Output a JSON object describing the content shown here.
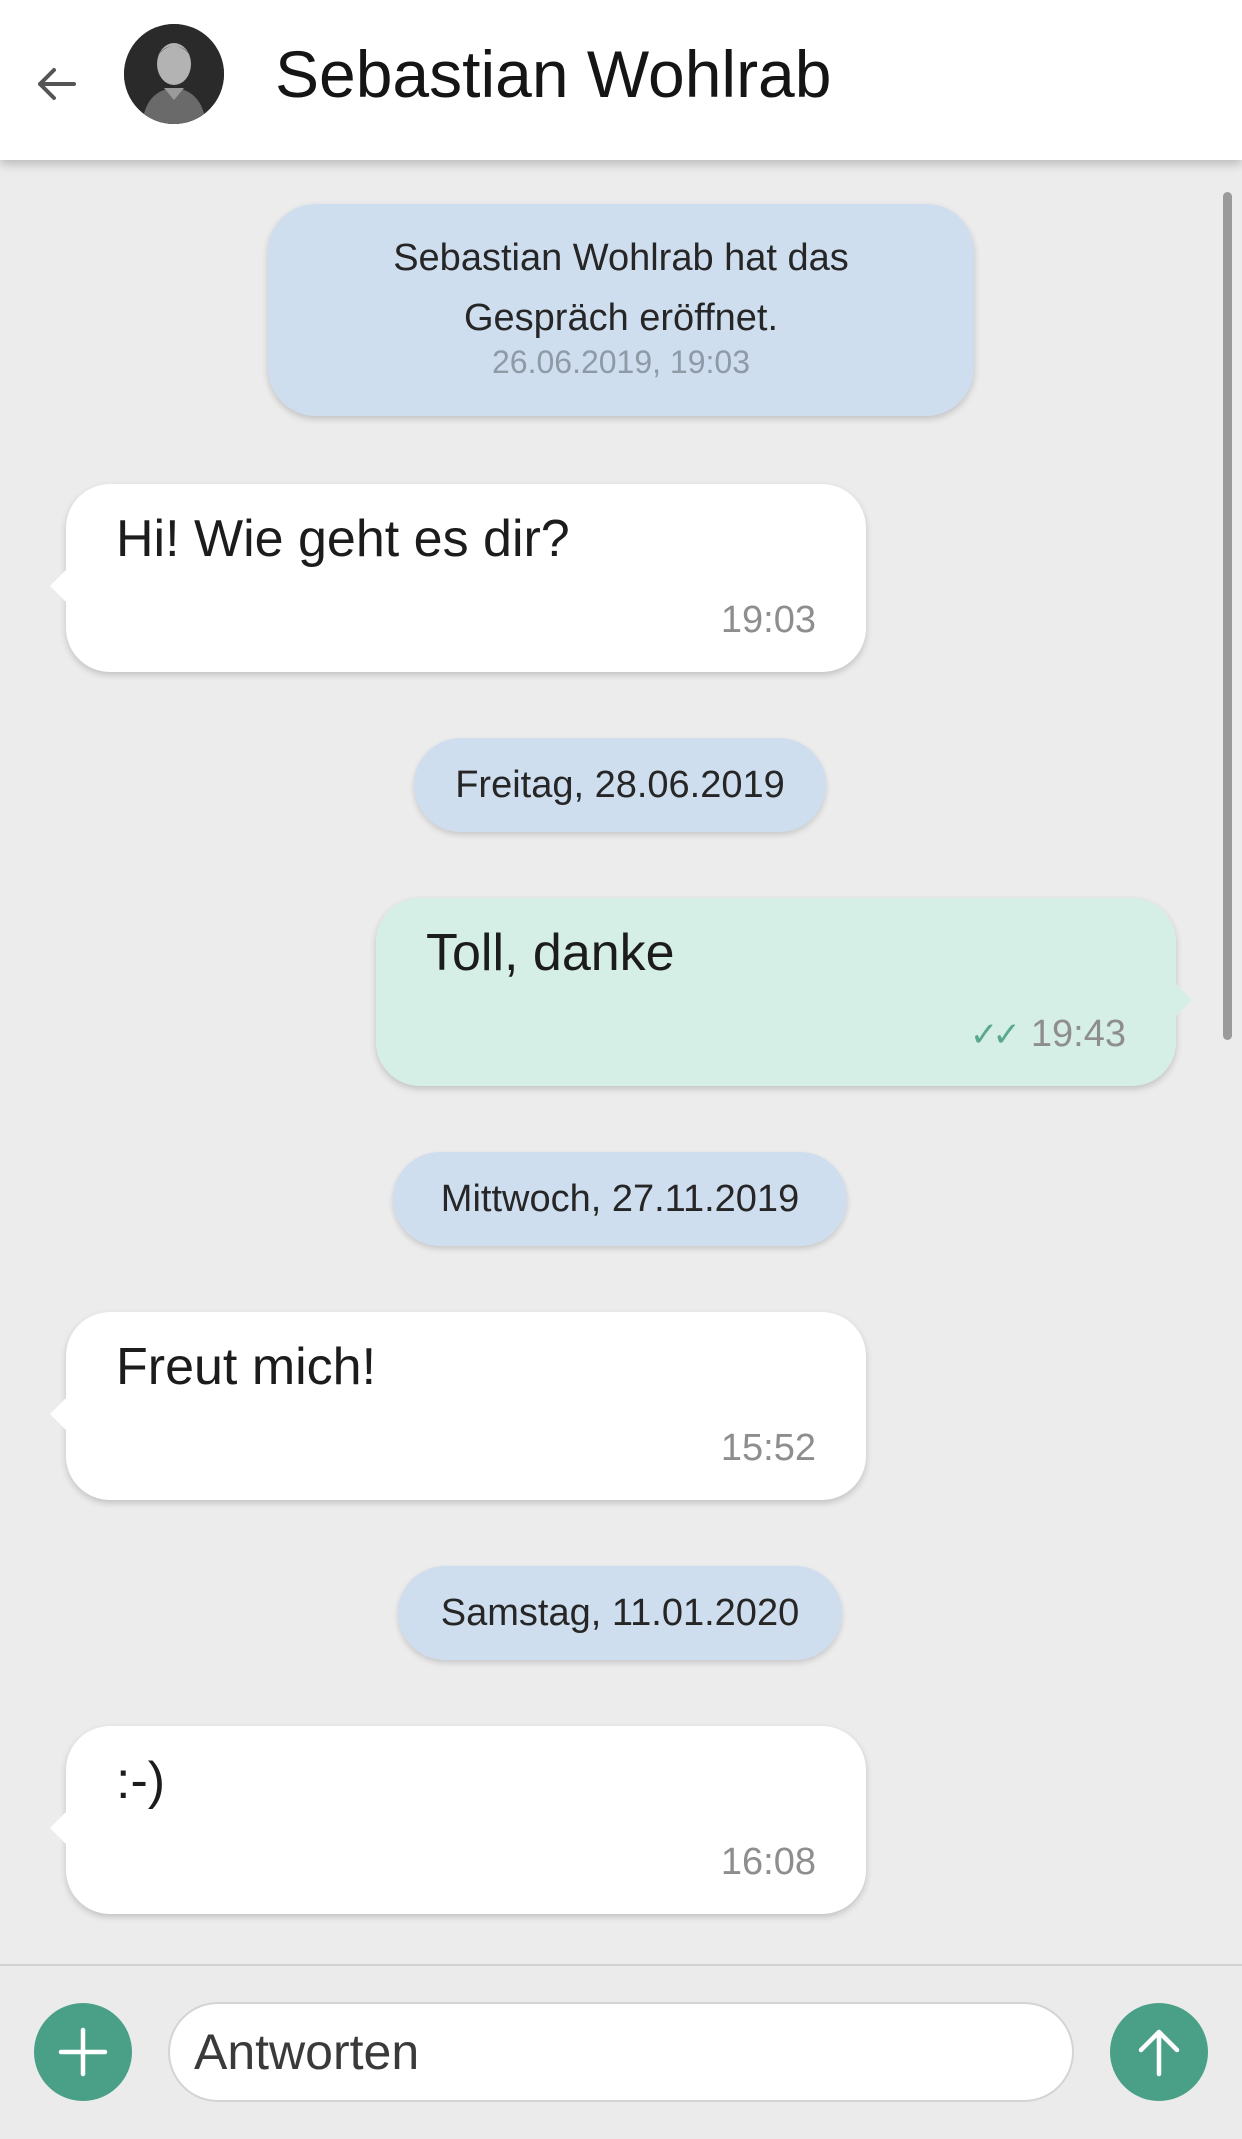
{
  "header": {
    "contact_name": "Sebastian Wohlrab",
    "back_icon": "arrow-left-icon",
    "avatar": "contact-avatar-photo"
  },
  "conversation": {
    "system_message": {
      "text": "Sebastian Wohlrab hat das Gespräch eröffnet.",
      "timestamp": "26.06.2019, 19:03"
    },
    "messages": [
      {
        "direction": "incoming",
        "text": "Hi! Wie geht es dir?",
        "time": "19:03"
      },
      {
        "date_separator": "Freitag, 28.06.2019"
      },
      {
        "direction": "outgoing",
        "text": "Toll, danke",
        "time": "19:43",
        "status": "read"
      },
      {
        "date_separator": "Mittwoch, 27.11.2019"
      },
      {
        "direction": "incoming",
        "text": "Freut mich!",
        "time": "15:52"
      },
      {
        "date_separator": "Samstag, 11.01.2020"
      },
      {
        "direction": "incoming",
        "text": ":-)",
        "time": "16:08"
      }
    ]
  },
  "composer": {
    "placeholder": "Antworten",
    "value": "",
    "add_icon": "plus-icon",
    "send_icon": "arrow-up-icon"
  },
  "colors": {
    "accent": "#4aa086",
    "incoming_bubble": "#ffffff",
    "outgoing_bubble": "#d6efe6",
    "system_bubble": "#cfdeee",
    "background": "#ececec",
    "read_check": "#5aa98d"
  }
}
